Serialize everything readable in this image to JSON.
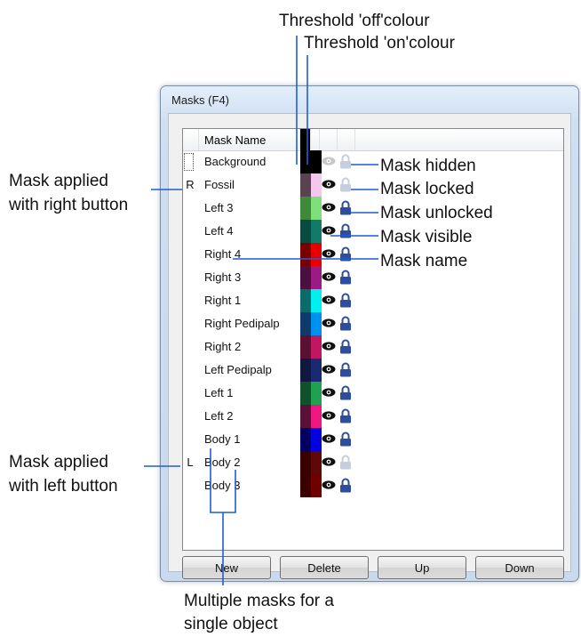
{
  "window": {
    "title": "Masks (F4)"
  },
  "list": {
    "header_name": "Mask Name",
    "rows": [
      {
        "mark": "",
        "name": "Background",
        "off": "#000000",
        "on": "#000000",
        "visible": false,
        "locked": false
      },
      {
        "mark": "R",
        "name": "Fossil",
        "off": "#5a4350",
        "on": "#f7c6ee",
        "visible": true,
        "locked": false
      },
      {
        "mark": "",
        "name": "Left 3",
        "off": "#3f8a3a",
        "on": "#7de07a",
        "visible": true,
        "locked": true
      },
      {
        "mark": "",
        "name": "Left 4",
        "off": "#0b4a40",
        "on": "#137a6a",
        "visible": true,
        "locked": true
      },
      {
        "mark": "",
        "name": "Right 4",
        "off": "#7a0000",
        "on": "#e80000",
        "visible": true,
        "locked": true
      },
      {
        "mark": "",
        "name": "Right 3",
        "off": "#4a1040",
        "on": "#9c1a84",
        "visible": true,
        "locked": true
      },
      {
        "mark": "",
        "name": "Right 1",
        "off": "#0c6a6a",
        "on": "#00f0f0",
        "visible": true,
        "locked": true
      },
      {
        "mark": "",
        "name": "Right Pedipalp",
        "off": "#103a6a",
        "on": "#0090f0",
        "visible": true,
        "locked": true
      },
      {
        "mark": "",
        "name": "Right 2",
        "off": "#5a1030",
        "on": "#c01860",
        "visible": true,
        "locked": true
      },
      {
        "mark": "",
        "name": "Left Pedipalp",
        "off": "#101840",
        "on": "#1a2a70",
        "visible": true,
        "locked": true
      },
      {
        "mark": "",
        "name": "Left 1",
        "off": "#10502a",
        "on": "#20a050",
        "visible": true,
        "locked": true
      },
      {
        "mark": "",
        "name": "Left 2",
        "off": "#5a1038",
        "on": "#f01880",
        "visible": true,
        "locked": true
      },
      {
        "mark": "",
        "name": "Body 1",
        "off": "#000060",
        "on": "#0000e0",
        "visible": true,
        "locked": true
      },
      {
        "mark": "L",
        "name": "Body 2",
        "off": "#3a0000",
        "on": "#600808",
        "visible": true,
        "locked": false
      },
      {
        "mark": "",
        "name": "Body 3",
        "off": "#3a0000",
        "on": "#700000",
        "visible": true,
        "locked": true
      }
    ]
  },
  "buttons": {
    "new": "New",
    "delete": "Delete",
    "up": "Up",
    "down": "Down"
  },
  "annotations": {
    "threshold_off": "Threshold 'off'colour",
    "threshold_on": "Threshold 'on'colour",
    "mask_hidden": "Mask hidden",
    "mask_locked": "Mask locked",
    "mask_unlocked": "Mask unlocked",
    "mask_visible": "Mask visible",
    "mask_name": "Mask name",
    "applied_right_1": "Mask applied",
    "applied_right_2": "with right button",
    "applied_left_1": "Mask applied",
    "applied_left_2": "with left button",
    "multiple_1": "Multiple masks for a",
    "multiple_2": "single object"
  },
  "colors": {
    "callout_line": "#1f5fd0",
    "lock_blue": "#2e4d9a",
    "lock_faded": "#c6cedd"
  }
}
